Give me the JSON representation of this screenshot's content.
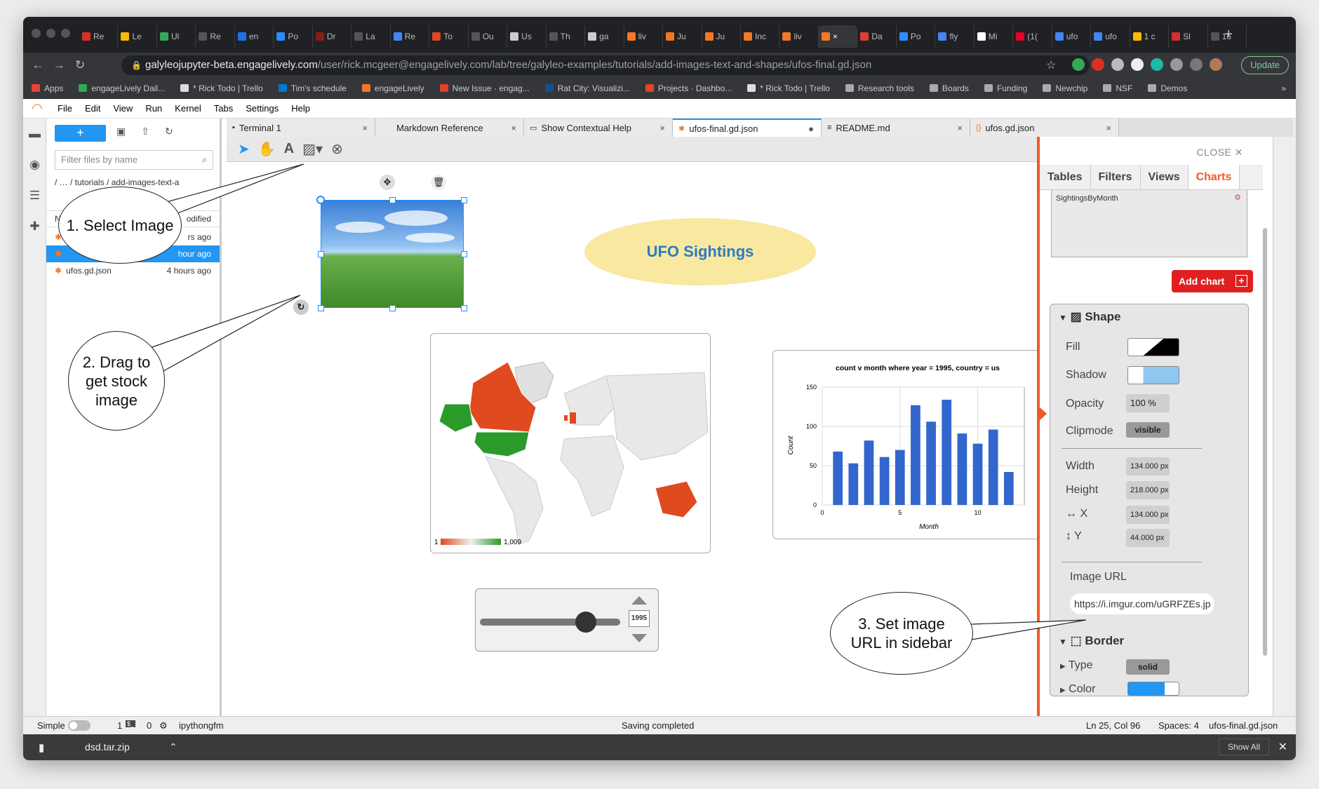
{
  "browser": {
    "tabs": [
      {
        "label": "Re",
        "color": "#d93025"
      },
      {
        "label": "Le",
        "color": "#fbbc04"
      },
      {
        "label": "Ul",
        "color": "#34a853"
      },
      {
        "label": "Re",
        "color": "#555"
      },
      {
        "label": "en",
        "color": "#1a73e8"
      },
      {
        "label": "Po",
        "color": "#2d8cff"
      },
      {
        "label": "Dr",
        "color": "#8b1a1a"
      },
      {
        "label": "La",
        "color": "#555"
      },
      {
        "label": "Re",
        "color": "#4285f4"
      },
      {
        "label": "To",
        "color": "#e24329"
      },
      {
        "label": "Ou",
        "color": "#555"
      },
      {
        "label": "Us",
        "color": "#ccc"
      },
      {
        "label": "Th",
        "color": "#555"
      },
      {
        "label": "ga",
        "color": "#ccc"
      },
      {
        "label": "liv",
        "color": "#f37726"
      },
      {
        "label": "Ju",
        "color": "#f37726"
      },
      {
        "label": "Ju",
        "color": "#f37726"
      },
      {
        "label": "Inc",
        "color": "#f37726"
      },
      {
        "label": "liv",
        "color": "#f37726"
      },
      {
        "label": "×",
        "color": "#f37726"
      },
      {
        "label": "Da",
        "color": "#e53935"
      },
      {
        "label": "Po",
        "color": "#2d8cff"
      },
      {
        "label": "fly",
        "color": "#4285f4"
      },
      {
        "label": "Mi",
        "color": "#fff"
      },
      {
        "label": "(1(",
        "color": "#e60023"
      },
      {
        "label": "ufo",
        "color": "#4285f4"
      },
      {
        "label": "ufo",
        "color": "#4285f4"
      },
      {
        "label": "1 c",
        "color": "#ffb900"
      },
      {
        "label": "Sl",
        "color": "#d32f2f"
      },
      {
        "label": "16",
        "color": "#555"
      }
    ],
    "new_tab": "+",
    "url_host": "galyleojupyter-beta.engagelively.com",
    "url_path": "/user/rick.mcgeer@engagelively.com/lab/tree/galyleo-examples/tutorials/add-images-text-and-shapes/ufos-final.gd.json",
    "update_label": "Update",
    "bookmarks": [
      {
        "label": "Apps",
        "color": "#e94235"
      },
      {
        "label": "engageLively Dail...",
        "color": "#34a853"
      },
      {
        "label": "* Rick Todo | Trello",
        "color": "#ddd"
      },
      {
        "label": "Tim's schedule",
        "color": "#0078d4"
      },
      {
        "label": "engageLively",
        "color": "#f37726"
      },
      {
        "label": "New Issue · engag...",
        "color": "#e24329"
      },
      {
        "label": "Rat City: Visualizi...",
        "color": "#1a4f8b"
      },
      {
        "label": "Projects · Dashbo...",
        "color": "#e24329"
      },
      {
        "label": "* Rick Todo | Trello",
        "color": "#ddd"
      },
      {
        "label": "Research tools",
        "color": "#aaa"
      },
      {
        "label": "Boards",
        "color": "#aaa"
      },
      {
        "label": "Funding",
        "color": "#aaa"
      },
      {
        "label": "Newchip",
        "color": "#aaa"
      },
      {
        "label": "NSF",
        "color": "#aaa"
      },
      {
        "label": "Demos",
        "color": "#aaa"
      }
    ],
    "bookmarks_more": "»"
  },
  "menu": [
    "File",
    "Edit",
    "View",
    "Run",
    "Kernel",
    "Tabs",
    "Settings",
    "Help"
  ],
  "filebrowser": {
    "new_label": "+",
    "filter_placeholder": "Filter files by name",
    "breadcrumb": "/ … / tutorials / add-images-text-a",
    "header_name": "N",
    "header_modified": "odified",
    "rows": [
      {
        "name": "",
        "modified": "rs ago",
        "selected": false
      },
      {
        "name": "",
        "modified": "hour ago",
        "selected": true
      },
      {
        "name": "ufos.gd.json",
        "modified": "4 hours ago",
        "selected": false
      }
    ]
  },
  "doc_tabs": [
    {
      "label": "Terminal 1",
      "icon": "terminal-icon",
      "active": false,
      "close": "×"
    },
    {
      "label": "Markdown Reference",
      "icon": "",
      "active": false,
      "close": "×"
    },
    {
      "label": "Show Contextual Help",
      "icon": "help-icon",
      "active": false,
      "close": "×"
    },
    {
      "label": "ufos-final.gd.json",
      "icon": "galyleo-icon",
      "active": true,
      "close": "●"
    },
    {
      "label": "README.md",
      "icon": "markdown-icon",
      "active": false,
      "close": "×"
    },
    {
      "label": "ufos.gd.json",
      "icon": "json-icon",
      "active": false,
      "close": "×"
    }
  ],
  "canvas": {
    "title": "UFO Sightings",
    "slider_year": "1995",
    "map_legend_min": "1",
    "map_legend_max": "1,009"
  },
  "chart_data": {
    "type": "bar",
    "title": "count v month where year = 1995, country = us",
    "xlabel": "Month",
    "ylabel": "Count",
    "x": [
      1,
      2,
      3,
      4,
      5,
      6,
      7,
      8,
      9,
      10,
      11,
      12
    ],
    "values": [
      68,
      53,
      82,
      61,
      70,
      127,
      106,
      134,
      91,
      78,
      96,
      42
    ],
    "xlim": [
      0,
      13
    ],
    "ylim": [
      0,
      150
    ],
    "xticks": [
      0,
      5,
      10
    ],
    "yticks": [
      0,
      50,
      100,
      150
    ],
    "color": "#3366cc",
    "grid": true
  },
  "sidebar": {
    "close_label": "CLOSE",
    "tabs": [
      "Tables",
      "Filters",
      "Views",
      "Charts"
    ],
    "active_tab": "Charts",
    "chart_list": [
      "SightingsByMonth"
    ],
    "add_chart_label": "Add chart",
    "shape_title": "Shape",
    "fill_label": "Fill",
    "shadow_label": "Shadow",
    "opacity_label": "Opacity",
    "opacity_value": "100 %",
    "clipmode_label": "Clipmode",
    "clipmode_value": "visible",
    "width_label": "Width",
    "width_value": "134.000 px",
    "height_label": "Height",
    "height_value": "218.000 px",
    "x_label": "X",
    "x_value": "134.000 px",
    "y_label": "Y",
    "y_value": "44.000 px",
    "image_url_label": "Image URL",
    "image_url_value": "https://i.imgur.com/uGRFZEs.jp",
    "border_title": "Border",
    "type_label": "Type",
    "type_value": "solid",
    "color_label": "Color",
    "accent": "#f15a24"
  },
  "callouts": {
    "c1": "1. Select Image",
    "c2": "2. Drag to get stock image",
    "c3": "3. Set image URL in sidebar"
  },
  "status": {
    "mode": "Simple",
    "terminals": "1",
    "kernels": "0",
    "kernel_name": "ipythongfm",
    "message": "Saving completed",
    "position": "Ln 25, Col 96",
    "spaces": "Spaces: 4",
    "filename": "ufos-final.gd.json"
  },
  "downloads": {
    "file": "dsd.tar.zip",
    "show_all": "Show All"
  }
}
